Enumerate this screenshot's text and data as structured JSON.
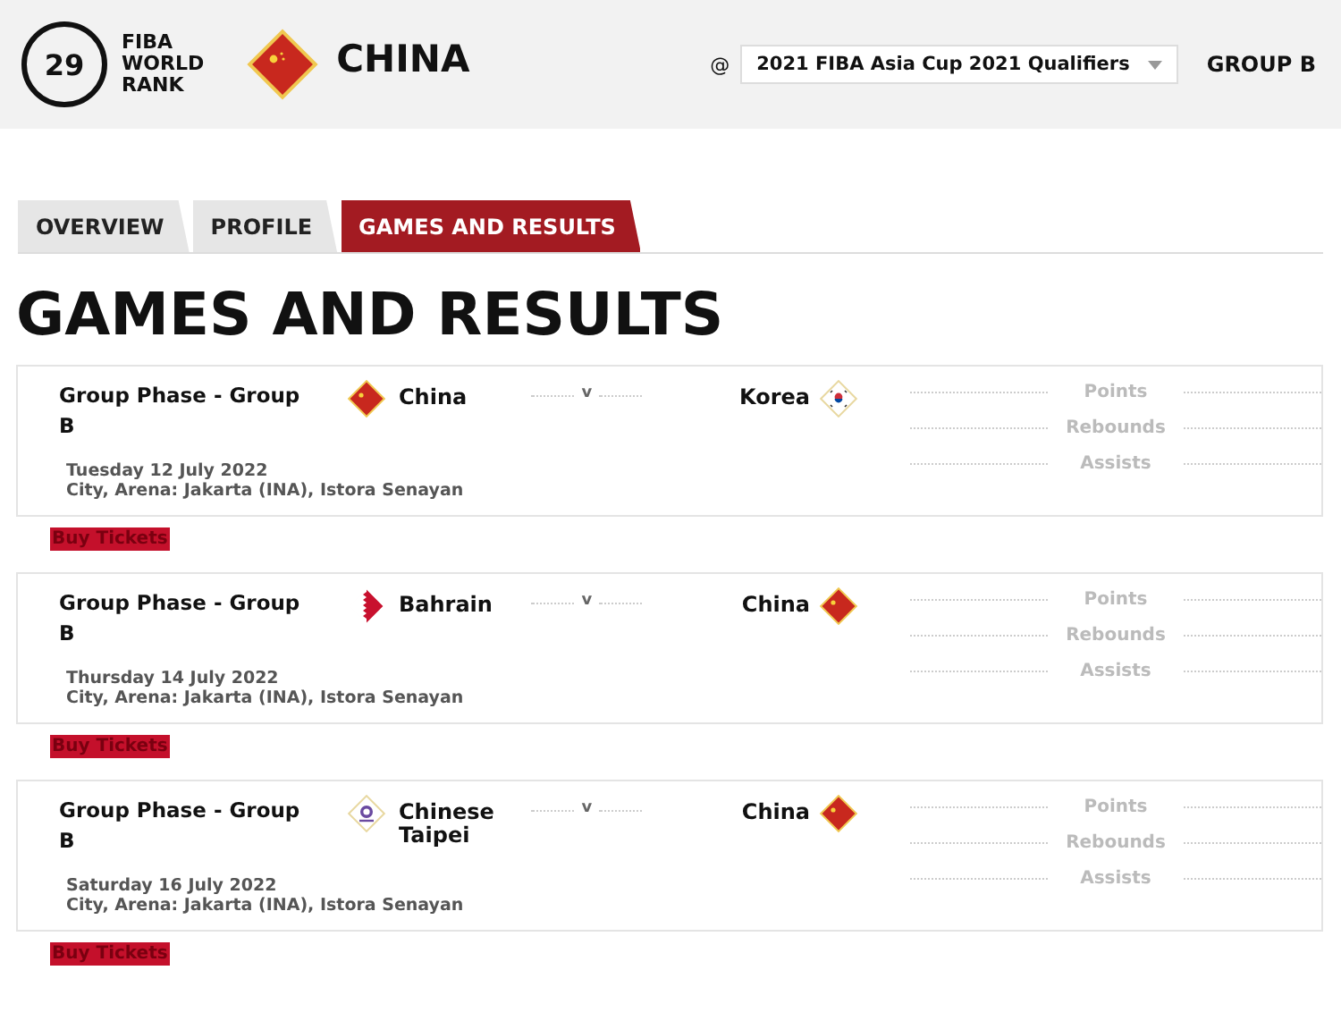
{
  "header": {
    "rank": "29",
    "rank_label": [
      "FIBA",
      "WORLD",
      "RANK"
    ],
    "team": {
      "name": "CHINA",
      "kind": "china"
    },
    "at": "@",
    "competition": "2021 FIBA Asia Cup 2021 Qualifiers",
    "group": "GROUP B"
  },
  "tabs": [
    {
      "label": "OVERVIEW",
      "selected": false
    },
    {
      "label": "PROFILE",
      "selected": false
    },
    {
      "label": "GAMES AND RESULTS",
      "selected": true
    }
  ],
  "title": "GAMES AND RESULTS",
  "games": [
    {
      "phase": "Group Phase - Group B",
      "home": {
        "name": "China",
        "kind": "china"
      },
      "vs": "v",
      "away": {
        "name": "Korea",
        "kind": "korea"
      },
      "date": "Tuesday 12 July 2022",
      "venue": "City, Arena: Jakarta (INA), Istora Senayan",
      "stats": [
        "Points",
        "Rebounds",
        "Assists"
      ],
      "tickets": "Buy Tickets"
    },
    {
      "phase": "Group Phase - Group B",
      "home": {
        "name": "Bahrain",
        "kind": "bahrain"
      },
      "vs": "v",
      "away": {
        "name": "China",
        "kind": "china"
      },
      "date": "Thursday 14 July 2022",
      "venue": "City, Arena: Jakarta (INA), Istora Senayan",
      "stats": [
        "Points",
        "Rebounds",
        "Assists"
      ],
      "tickets": "Buy Tickets"
    },
    {
      "phase": "Group Phase - Group B",
      "home": {
        "name": "Chinese Taipei",
        "kind": "taipei"
      },
      "vs": "v",
      "away": {
        "name": "China",
        "kind": "china"
      },
      "date": "Saturday 16 July 2022",
      "venue": "City, Arena: Jakarta (INA), Istora Senayan",
      "stats": [
        "Points",
        "Rebounds",
        "Assists"
      ],
      "tickets": "Buy Tickets"
    }
  ]
}
